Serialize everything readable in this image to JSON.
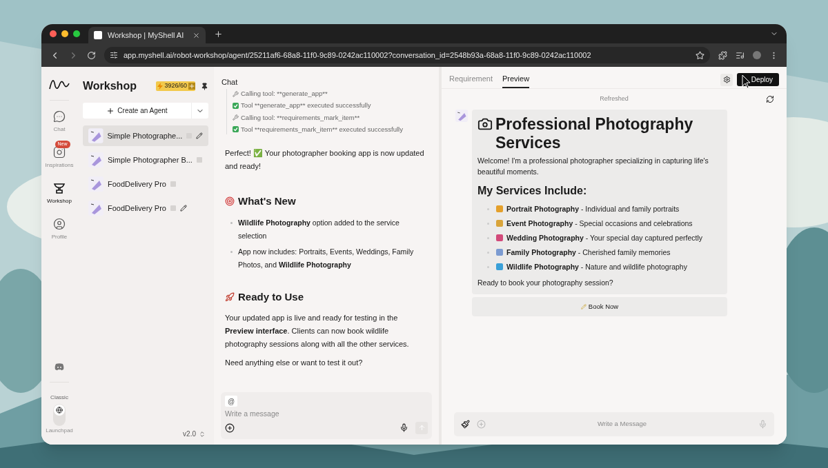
{
  "browser": {
    "tab_title": "Workshop | MyShell AI",
    "url": "app.myshell.ai/robot-workshop/agent/25211af6-68a8-11f0-9c89-0242ac110002?conversation_id=2548b93a-68a8-11f0-9c89-0242ac110002"
  },
  "rail": {
    "items": [
      {
        "label": "Chat",
        "selected": false
      },
      {
        "label": "Inspirations",
        "selected": false,
        "badge": "New"
      },
      {
        "label": "Workshop",
        "selected": true
      },
      {
        "label": "Profile",
        "selected": false
      }
    ],
    "mode_labels": [
      "Classic",
      "Launchpad"
    ],
    "launchpad_on": false
  },
  "sidebar": {
    "title": "Workshop",
    "credits": "3926/60",
    "create_button": "Create an Agent",
    "agents": [
      {
        "name": "Simple Photographe...",
        "selected": true,
        "editable": true
      },
      {
        "name": "Simple Photographer B...",
        "selected": false,
        "editable": false
      },
      {
        "name": "FoodDelivery Pro",
        "selected": false,
        "editable": false
      },
      {
        "name": "FoodDelivery Pro",
        "selected": false,
        "editable": true
      }
    ],
    "version": "v2.0"
  },
  "chat": {
    "header": "Chat",
    "tool_log": [
      {
        "kind": "call",
        "text": "Calling tool: **generate_app**"
      },
      {
        "kind": "success",
        "text": "Tool **generate_app** executed successfully"
      },
      {
        "kind": "call",
        "text": "Calling tool: **requirements_mark_item**"
      },
      {
        "kind": "success",
        "text": "Tool **requirements_mark_item** executed successfully"
      }
    ],
    "blocks": [
      {
        "kind": "paragraph",
        "text": "Perfect! ✅ Your photographer booking app is now updated and ready!"
      },
      {
        "kind": "heading",
        "text": "What's New"
      },
      {
        "kind": "bullets",
        "items": [
          "**Wildlife Photography** option added to the service selection",
          "App now includes: Portraits, Events, Weddings, Family Photos, and **Wildlife Photography**"
        ]
      },
      {
        "kind": "heading",
        "text": "Ready to Use"
      },
      {
        "kind": "paragraph",
        "text": "Your updated app is live and ready for testing in the **Preview interface**. Clients can now book wildlife photography sessions along with all the other services."
      },
      {
        "kind": "paragraph",
        "text": "Need anything else or want to test it out?"
      }
    ],
    "mention_symbol": "@",
    "input_placeholder": "Write a message"
  },
  "preview": {
    "tabs": [
      {
        "label": "Requirement",
        "selected": false
      },
      {
        "label": "Preview",
        "selected": true
      }
    ],
    "deploy_button": "Deploy",
    "status": "Refreshed",
    "card": {
      "title": "Professional Photography Services",
      "intro": "Welcome! I'm a professional photographer specializing in capturing life's beautiful moments.",
      "subheading": "My Services Include:",
      "services": [
        "**Portrait Photography** - Individual and family portraits",
        "**Event Photography** - Special occasions and celebrations",
        "**Wedding Photography** - Your special day captured perfectly",
        "**Family Photography** - Cherished family memories",
        "**Wildlife Photography** - Nature and wildlife photography"
      ],
      "closing": "Ready to book your photography session?"
    },
    "book_button": "Book Now",
    "input_placeholder": "Write a Message"
  }
}
